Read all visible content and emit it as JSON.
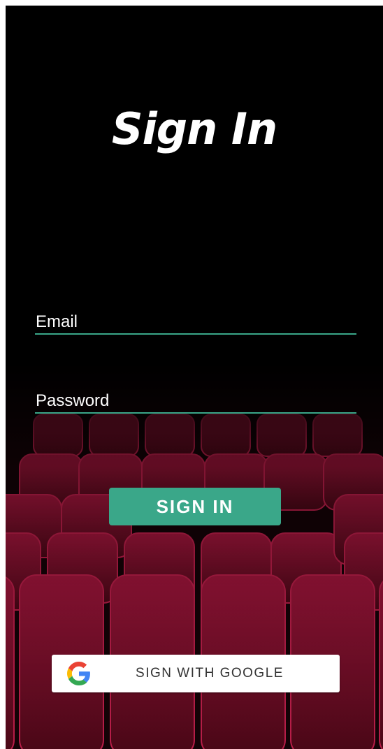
{
  "screen": {
    "title": "Sign In",
    "background": "theater-seats-image"
  },
  "form": {
    "email_placeholder": "Email",
    "password_placeholder": "Password",
    "sign_in_label": "SIGN IN",
    "google_label": "SIGN WITH GOOGLE",
    "google_icon": "google-g-logo"
  },
  "colors": {
    "accent": "#3aa789",
    "background": "#000000",
    "seat": "#8a1232"
  }
}
